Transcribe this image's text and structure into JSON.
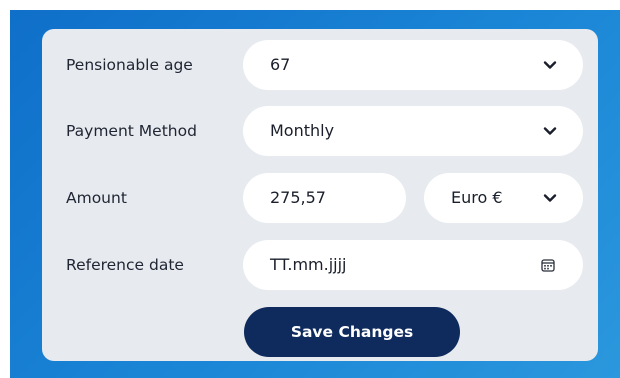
{
  "form": {
    "pensionable_age": {
      "label": "Pensionable age",
      "value": "67"
    },
    "payment_method": {
      "label": "Payment Method",
      "value": "Monthly"
    },
    "amount": {
      "label": "Amount",
      "value": "275,57",
      "currency": "Euro €"
    },
    "reference_date": {
      "label": "Reference date",
      "placeholder": "TT.mm.jjjj"
    },
    "save_label": "Save Changes"
  },
  "colors": {
    "frame_gradient_start": "#0f6fc9",
    "frame_gradient_end": "#2b97dd",
    "panel_background": "#e7eaee",
    "field_background": "#ffffff",
    "button_background": "#0f2a5c",
    "button_text": "#ffffff",
    "text": "#1f2533"
  },
  "icons": {
    "dropdown": "chevron-down-icon",
    "date_picker": "calendar-icon"
  }
}
